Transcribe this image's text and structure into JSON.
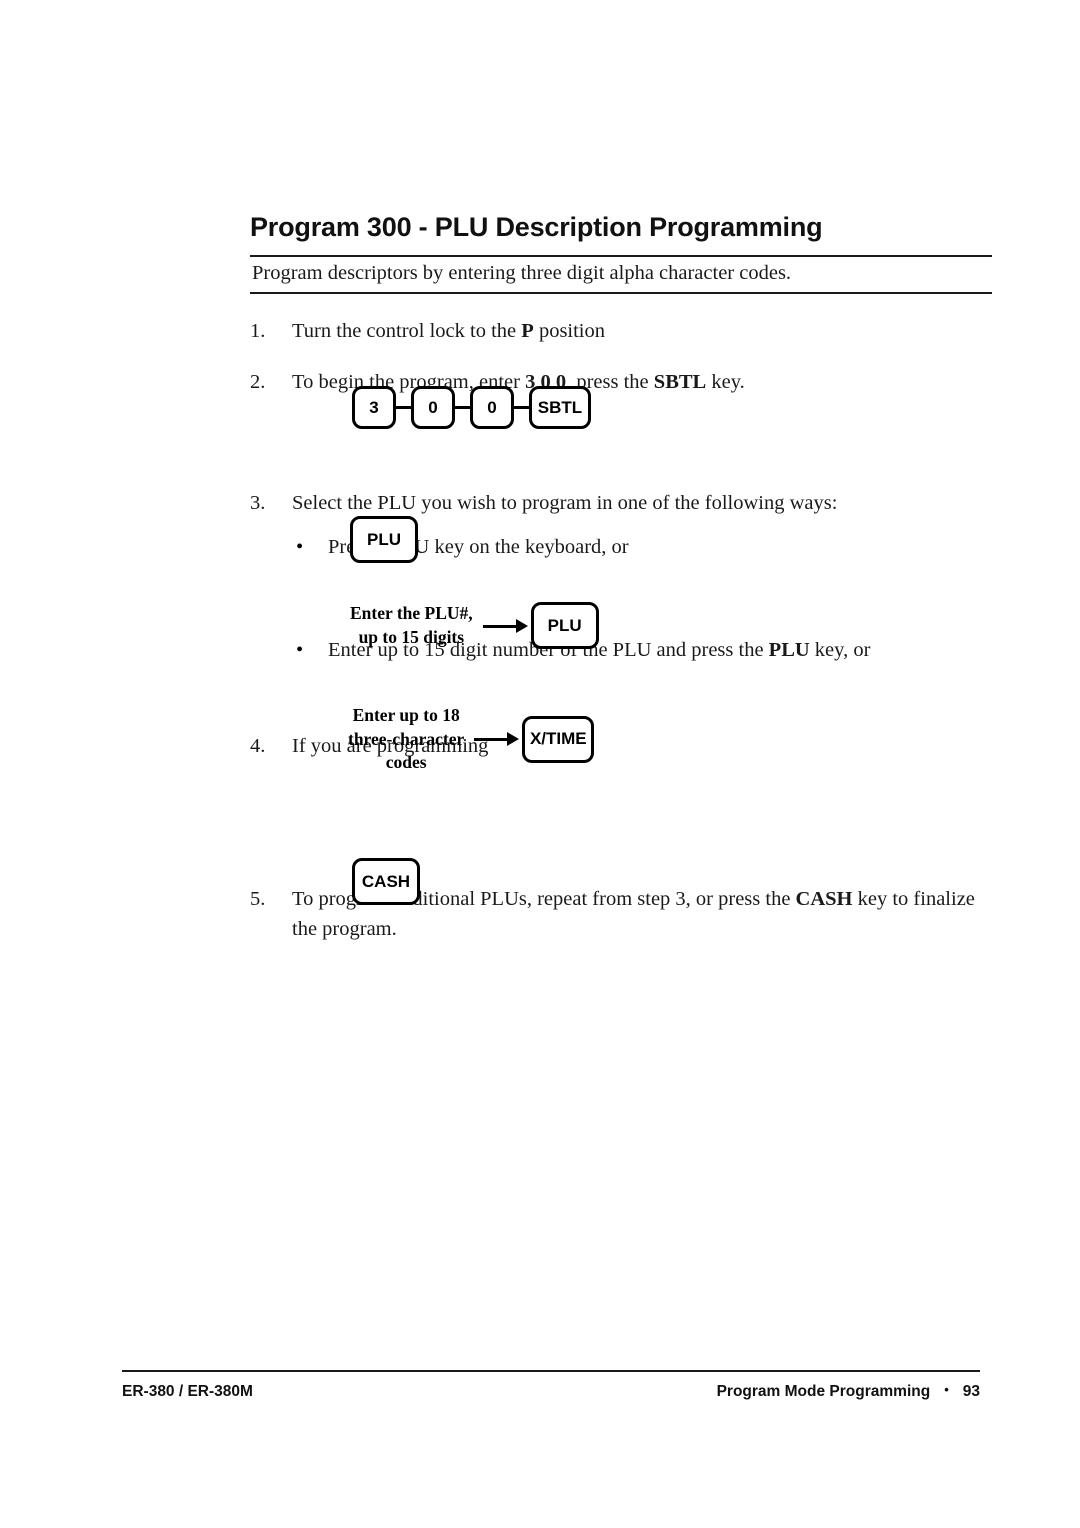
{
  "document": {
    "title": "Program 300 - PLU Description Programming",
    "subtitle": "Program descriptors by entering three digit alpha character codes."
  },
  "steps": [
    {
      "number": "1.",
      "text_parts": [
        {
          "text": "Turn the control lock to the ",
          "bold": false
        },
        {
          "text": "P",
          "bold": true
        },
        {
          "text": " position",
          "bold": false
        }
      ],
      "plain": "Turn the control lock to the P position"
    },
    {
      "number": "2.",
      "text_parts": [
        {
          "text": "To begin the program, enter ",
          "bold": false
        },
        {
          "text": "3 0 0",
          "bold": true
        },
        {
          "text": ", press the ",
          "bold": false
        },
        {
          "text": "SBTL",
          "bold": true
        },
        {
          "text": " key.",
          "bold": false
        }
      ],
      "plain": "To begin the program, enter 3 0 0, press the SBTL key."
    },
    {
      "number": "3.",
      "text_parts": [
        {
          "text": "Select the PLU you wish to program in one of the following ways:",
          "bold": false
        }
      ],
      "plain": "Select the PLU you wish to program in one of the following ways:"
    },
    {
      "number": "4.",
      "text_parts": [
        {
          "text": "If you are programming",
          "bold": false
        }
      ],
      "plain": "If you are programming"
    },
    {
      "number": "5.",
      "text_parts": [
        {
          "text": "To program additional PLUs, repeat from step 3, or press the ",
          "bold": false
        },
        {
          "text": "CASH",
          "bold": true
        },
        {
          "text": " key to finalize the program.",
          "bold": false
        }
      ],
      "plain": "To program additional PLUs, repeat from step 3, or press the CASH key to finalize the program."
    }
  ],
  "bullets": [
    {
      "marker": "•",
      "plain": "Press a PLU key on the keyboard, or",
      "text_parts": [
        {
          "text": "Press a PLU key on the keyboard, or",
          "bold": false
        }
      ]
    },
    {
      "marker": "•",
      "plain": "Enter up to 15 digit number of the PLU and press the PLU key, or",
      "text_parts": [
        {
          "text": "Enter up to 15 digit number of the PLU and press the ",
          "bold": false
        },
        {
          "text": "PLU",
          "bold": true
        },
        {
          "text": " key, or",
          "bold": false
        }
      ]
    }
  ],
  "key_sequence_300": {
    "keys": [
      "3",
      "0",
      "0",
      "SBTL"
    ]
  },
  "key_plu_single": {
    "label": "PLU"
  },
  "diagram_plu_entry": {
    "label": "Enter the PLU#,\nup to 15 digits",
    "arrow": "right-arrow",
    "key": "PLU"
  },
  "diagram_xtime_entry": {
    "label": "Enter up to 18\nthree-character\ncodes",
    "arrow": "right-arrow",
    "key": "X/TIME"
  },
  "key_cash_single": {
    "label": "CASH"
  },
  "footer": {
    "left": "ER-380 / ER-380M",
    "right_title": "Program Mode Programming",
    "separator": "•",
    "page_number": "93"
  }
}
